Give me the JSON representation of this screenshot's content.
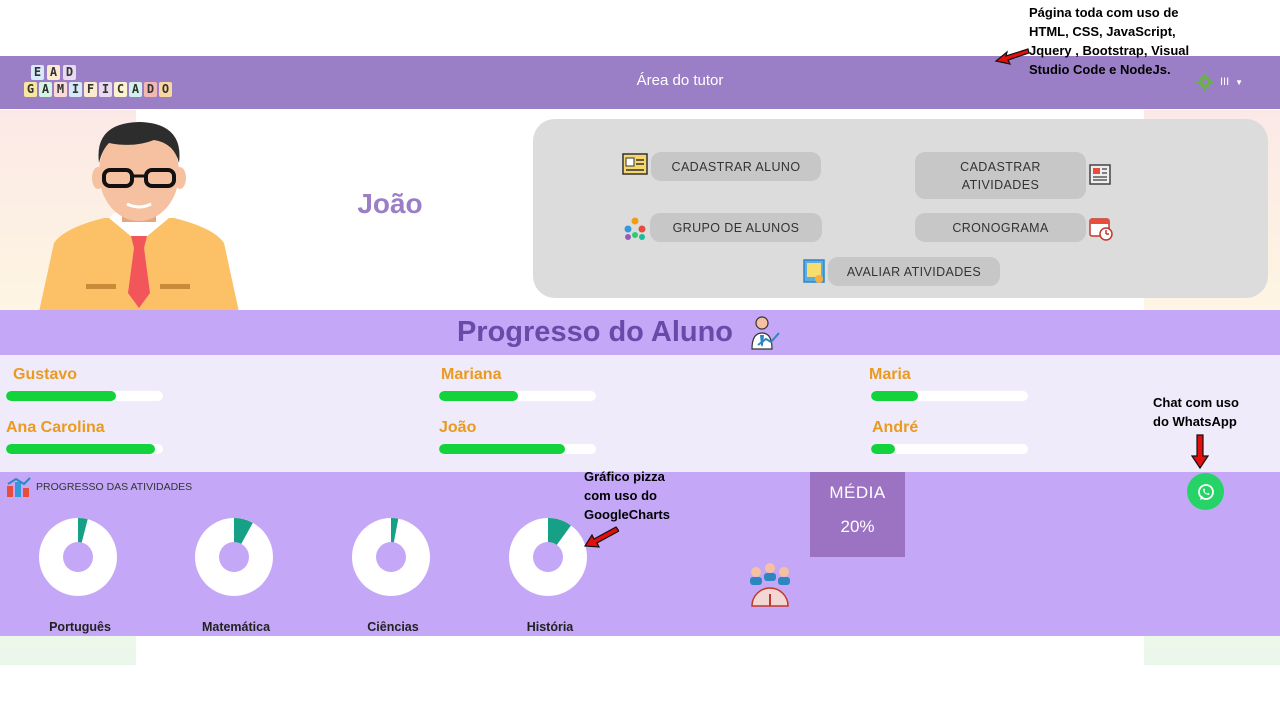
{
  "navbar": {
    "logo_row1": [
      "E",
      "A",
      "D"
    ],
    "logo_row2": [
      "G",
      "A",
      "M",
      "I",
      "F",
      "I",
      "C",
      "A",
      "D",
      "O"
    ],
    "title": "Área do tutor",
    "menu_glyph": "III"
  },
  "tutor": {
    "name": "João"
  },
  "actions": {
    "cadastrar_aluno": "CADASTRAR ALUNO",
    "cadastrar_atividades_line1": "CADASTRAR",
    "cadastrar_atividades_line2": "ATIVIDADES",
    "grupo_de_alunos": "GRUPO DE ALUNOS",
    "cronograma": "CRONOGRAMA",
    "avaliar_atividades": "AVALIAR ATIVIDADES"
  },
  "progress": {
    "title": "Progresso do Aluno",
    "students": [
      {
        "name": "Gustavo",
        "progress": 0.7
      },
      {
        "name": "Mariana",
        "progress": 0.5
      },
      {
        "name": "Maria",
        "progress": 0.3
      },
      {
        "name": "Ana Carolina",
        "progress": 0.95
      },
      {
        "name": "João",
        "progress": 0.8
      },
      {
        "name": "André",
        "progress": 0.15
      }
    ]
  },
  "activities": {
    "header": "PROGRESSO DAS ATIVIDADES",
    "subjects": [
      {
        "name": "Português",
        "fraction": 0.04
      },
      {
        "name": "Matemática",
        "fraction": 0.08
      },
      {
        "name": "Ciências",
        "fraction": 0.03
      },
      {
        "name": "História",
        "fraction": 0.1
      }
    ],
    "media_label": "MÉDIA",
    "media_value": "20%"
  },
  "annotations": {
    "top_right_1": "Página toda com uso de",
    "top_right_2": "HTML, CSS, JavaScript,",
    "top_right_3": "Jquery , Bootstrap, Visual",
    "top_right_4": "Studio Code e NodeJs.",
    "chart_1": "Gráfico pizza",
    "chart_2": "com uso do",
    "chart_3": "GoogleCharts",
    "chat_1": "Chat com uso",
    "chat_2": "do WhatsApp"
  },
  "colors": {
    "navbar": "#9b7fc6",
    "accent_purple": "#c4a7f7",
    "progress_fill": "#12d33b",
    "student_name": "#e99a1f",
    "donut_slice": "#16a085",
    "whatsapp": "#25d366"
  },
  "icons": [
    "whatsapp-icon",
    "id-card-icon",
    "newspaper-icon",
    "group-icon",
    "calendar-clock-icon",
    "photo-frame-icon",
    "presenter-icon",
    "chart-icon",
    "team-gauge-icon",
    "arrow-icon"
  ]
}
